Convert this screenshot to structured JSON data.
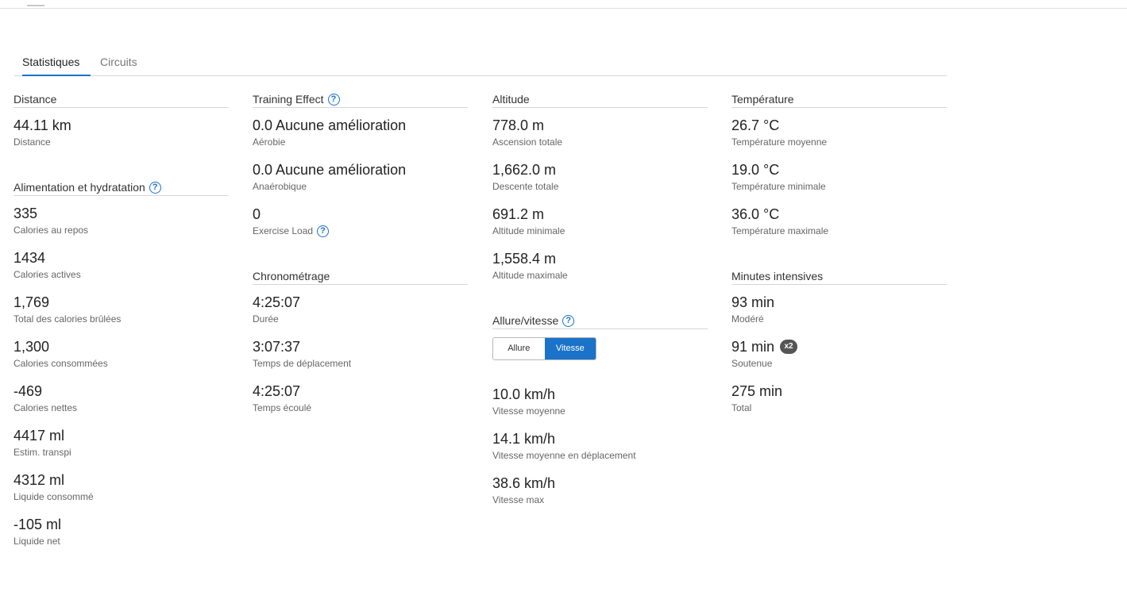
{
  "tabs": [
    {
      "label": "Statistiques",
      "active": true
    },
    {
      "label": "Circuits",
      "active": false
    }
  ],
  "colors": {
    "accent": "#1a73c8",
    "badge": "#555555"
  },
  "columns": {
    "c1": [
      {
        "title": "Distance",
        "help": false,
        "stats": [
          {
            "value": "44.11 km",
            "label": "Distance"
          }
        ]
      },
      {
        "title": "Alimentation et hydratation",
        "help": true,
        "stats": [
          {
            "value": "335",
            "label": "Calories au repos"
          },
          {
            "value": "1434",
            "label": "Calories actives"
          },
          {
            "value": "1,769",
            "label": "Total des calories brûlées"
          },
          {
            "value": "1,300",
            "label": "Calories consommées"
          },
          {
            "value": "-469",
            "label": "Calories nettes"
          },
          {
            "value": "4417 ml",
            "label": "Estim. transpi"
          },
          {
            "value": "4312 ml",
            "label": "Liquide consommé"
          },
          {
            "value": "-105 ml",
            "label": "Liquide net"
          }
        ]
      }
    ],
    "c2": [
      {
        "title": "Training Effect",
        "help": true,
        "stats": [
          {
            "value": "0.0 Aucune amélioration",
            "label": "Aérobie"
          },
          {
            "value": "0.0 Aucune amélioration",
            "label": "Anaérobique"
          },
          {
            "value": "0",
            "label": "Exercise Load",
            "label_help": true
          }
        ]
      },
      {
        "title": "Chronométrage",
        "help": false,
        "stats": [
          {
            "value": "4:25:07",
            "label": "Durée"
          },
          {
            "value": "3:07:37",
            "label": "Temps de déplacement"
          },
          {
            "value": "4:25:07",
            "label": "Temps écoulé"
          }
        ]
      }
    ],
    "c3": [
      {
        "title": "Altitude",
        "help": false,
        "stats": [
          {
            "value": "778.0 m",
            "label": "Ascension totale"
          },
          {
            "value": "1,662.0 m",
            "label": "Descente totale"
          },
          {
            "value": "691.2 m",
            "label": "Altitude minimale"
          },
          {
            "value": "1,558.4 m",
            "label": "Altitude maximale"
          }
        ]
      },
      {
        "title": "Allure/vitesse",
        "help": true,
        "toggle": [
          {
            "label": "Allure",
            "active": false
          },
          {
            "label": "Vitesse",
            "active": true
          }
        ],
        "stats": [
          {
            "value": "10.0 km/h",
            "label": "Vitesse moyenne"
          },
          {
            "value": "14.1 km/h",
            "label": "Vitesse moyenne en déplacement"
          },
          {
            "value": "38.6 km/h",
            "label": "Vitesse max"
          }
        ]
      }
    ],
    "c4": [
      {
        "title": "Température",
        "help": false,
        "stats": [
          {
            "value": "26.7 °C",
            "label": "Température moyenne"
          },
          {
            "value": "19.0 °C",
            "label": "Température minimale"
          },
          {
            "value": "36.0 °C",
            "label": "Température maximale"
          }
        ]
      },
      {
        "title": "Minutes intensives",
        "help": false,
        "stats": [
          {
            "value": "93 min",
            "label": "Modéré"
          },
          {
            "value": "91 min",
            "label": "Soutenue",
            "badge": "x2"
          },
          {
            "value": "275 min",
            "label": "Total"
          }
        ]
      }
    ]
  }
}
